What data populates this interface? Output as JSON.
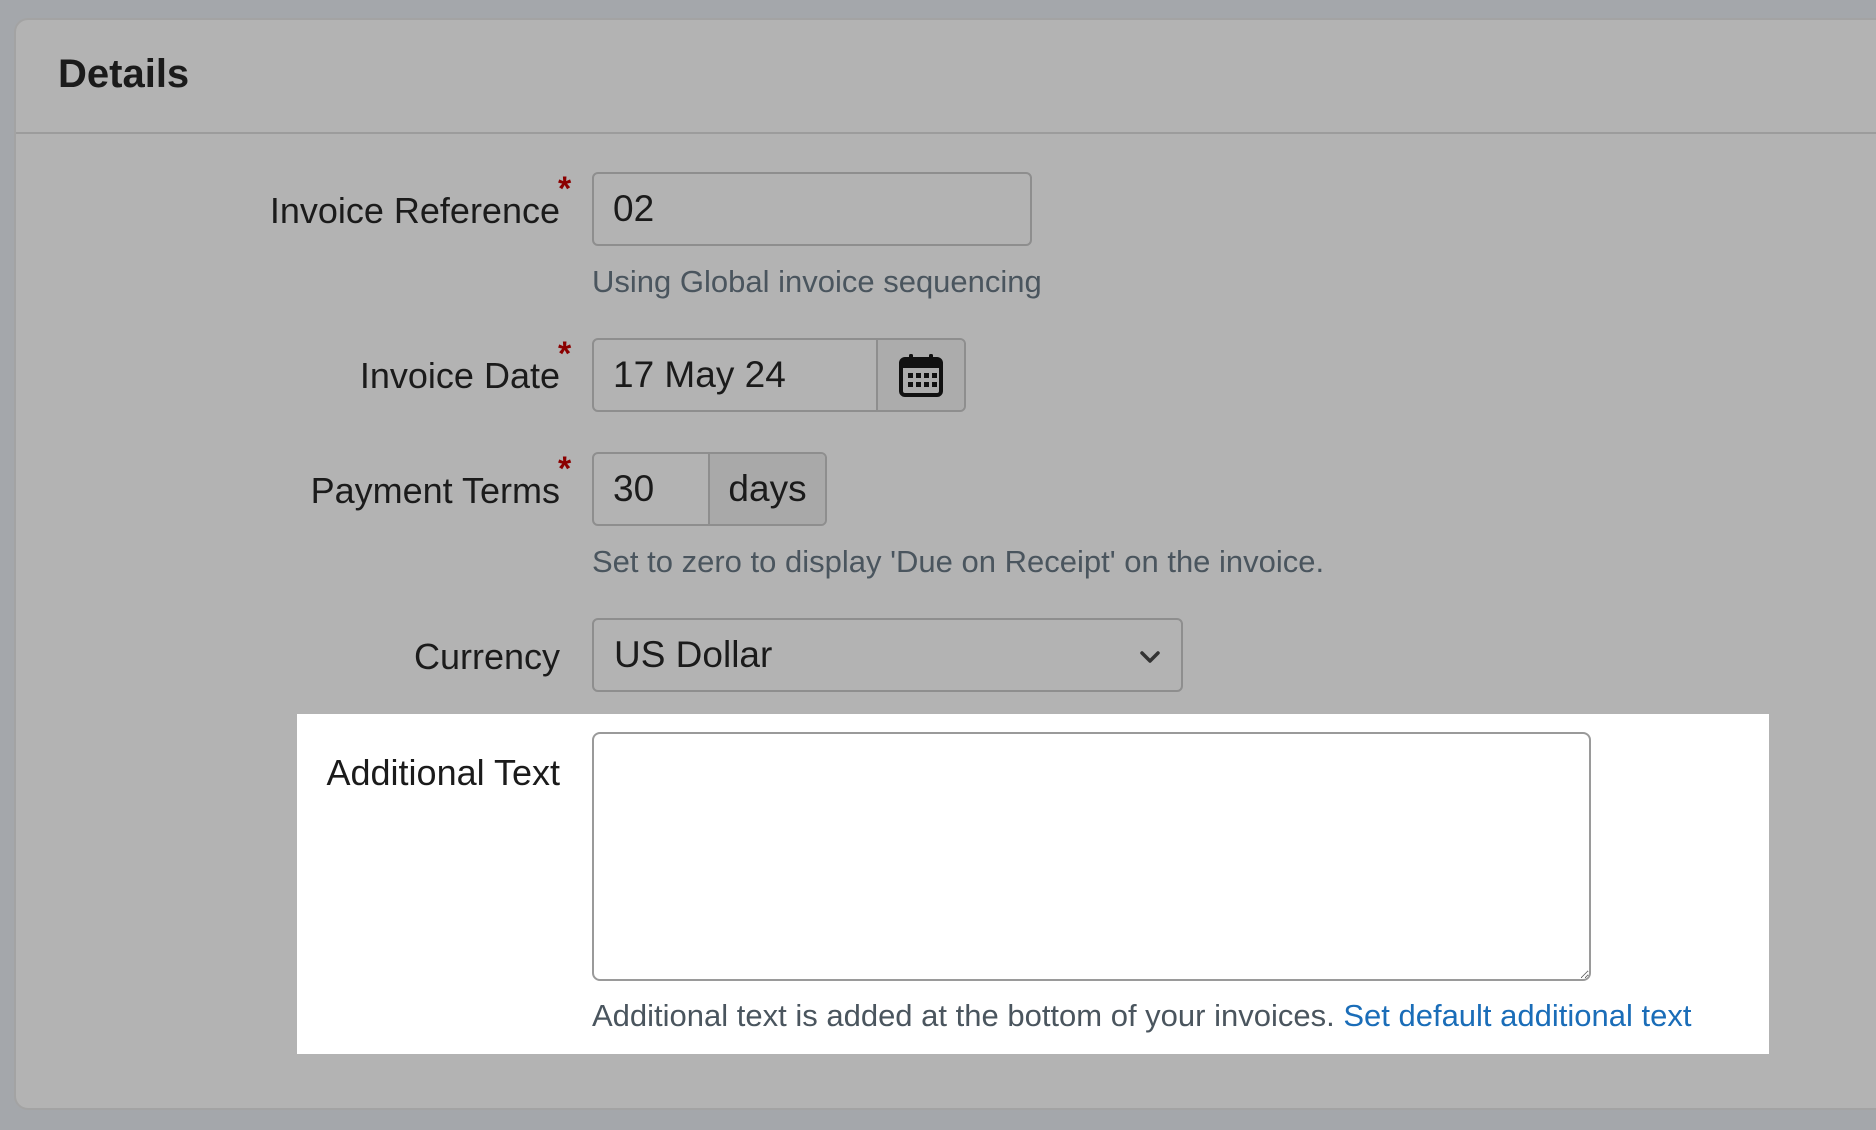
{
  "panel": {
    "title": "Details"
  },
  "form": {
    "invoice_reference": {
      "label": "Invoice Reference",
      "required_mark": "*",
      "value": "02",
      "help": "Using Global invoice sequencing"
    },
    "invoice_date": {
      "label": "Invoice Date",
      "required_mark": "*",
      "value": "17 May 24",
      "button_icon": "calendar-icon"
    },
    "payment_terms": {
      "label": "Payment Terms",
      "required_mark": "*",
      "value": "30",
      "unit": "days",
      "help": "Set to zero to display 'Due on Receipt' on the invoice."
    },
    "currency": {
      "label": "Currency",
      "selected": "US Dollar",
      "icon": "chevron-down-icon"
    },
    "additional_text": {
      "label": "Additional Text",
      "value": "",
      "help": "Additional text is added at the bottom of your invoices.",
      "link": "Set default additional text"
    }
  },
  "colors": {
    "required": "#8b0000",
    "link": "#1a6db8",
    "highlight_bg": "#ffffff"
  }
}
